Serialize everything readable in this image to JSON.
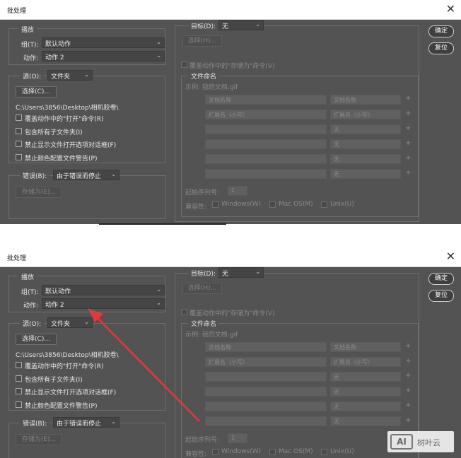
{
  "dialog": {
    "title": "批处理",
    "close_glyph": "✕"
  },
  "play": {
    "group_title": "播放",
    "set_label": "组(T):",
    "set_value": "默认动作",
    "action_label": "动作:",
    "action_value": "动作 2"
  },
  "source": {
    "label": "源(O):",
    "value": "文件夹",
    "choose_button": "选择(C)...",
    "path": "C:\\Users\\3856\\Desktop\\相机胶卷\\",
    "options": [
      "覆盖动作中的\"打开\"命令(R)",
      "包含所有子文件夹(I)",
      "禁止显示文件打开选项对话框(F)",
      "禁止颜色配置文件警告(P)"
    ]
  },
  "errors": {
    "label": "错误(B):",
    "value": "由于错误而停止",
    "save_as_button": "存储为(E)..."
  },
  "destination": {
    "label": "目标(D):",
    "value": "无",
    "choose_button": "选择(H)...",
    "override_label": "覆盖动作中的\"存储为\"命令(V)",
    "naming_title": "文件命名",
    "example": "示例: 我的文档.gif",
    "rows": [
      {
        "left": "文档名称",
        "right": "文档名称"
      },
      {
        "left": "扩展名（小写）",
        "right": "扩展名（小写）"
      },
      {
        "left": "",
        "right": "无"
      },
      {
        "left": "",
        "right": "无"
      },
      {
        "left": "",
        "right": "无"
      },
      {
        "left": "",
        "right": "无"
      }
    ],
    "plus_glyph": "+",
    "serial_label": "起始序列号:",
    "serial_value": "1",
    "compat_label": "兼容性:",
    "compat_windows": "Windows(W)",
    "compat_mac": "Mac OS(M)",
    "compat_unix": "Unix(U)"
  },
  "buttons": {
    "ok": "确定",
    "reset": "复位"
  },
  "watermark": {
    "logo": "AI",
    "text": "树叶云"
  },
  "colors": {
    "panel": "#535353",
    "annotation_arrow": "#e0393e"
  }
}
